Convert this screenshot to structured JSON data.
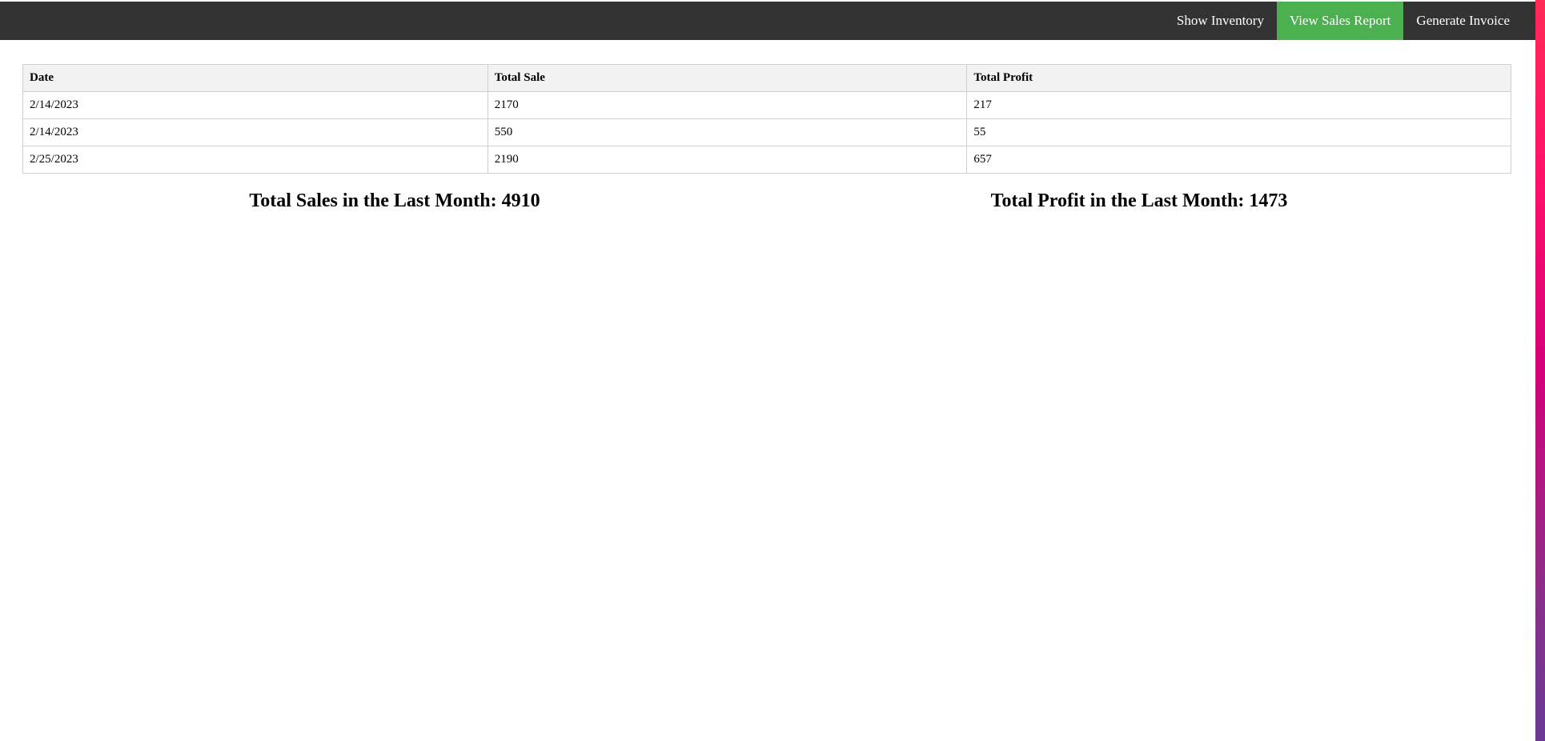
{
  "nav": {
    "items": [
      {
        "label": "Show Inventory",
        "active": false
      },
      {
        "label": "View Sales Report",
        "active": true
      },
      {
        "label": "Generate Invoice",
        "active": false
      }
    ],
    "active_color": "#4caf50",
    "bar_color": "#333333"
  },
  "table": {
    "headers": [
      "Date",
      "Total Sale",
      "Total Profit"
    ],
    "rows": [
      [
        "2/14/2023",
        "2170",
        "217"
      ],
      [
        "2/14/2023",
        "550",
        "55"
      ],
      [
        "2/25/2023",
        "2190",
        "657"
      ]
    ]
  },
  "summary": {
    "sales_text": "Total Sales in the Last Month: 4910",
    "profit_text": "Total Profit in the Last Month: 1473"
  }
}
